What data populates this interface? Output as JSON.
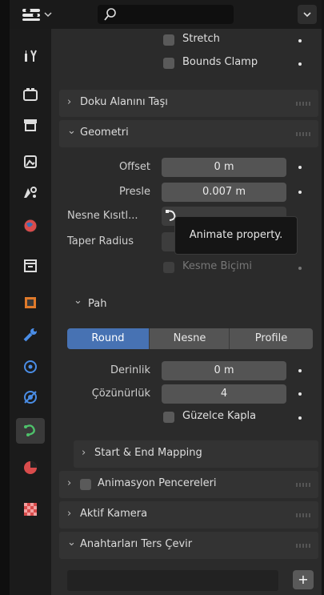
{
  "sections": {
    "stretch": "Stretch",
    "bounds_clamp": "Bounds Clamp",
    "doku": "Doku Alanını Taşı",
    "geometri": "Geometri",
    "offset_label": "Offset",
    "offset_value": "0 m",
    "presle_label": "Presle",
    "presle_value": "0.007 m",
    "nesne_kisit_label": "Nesne Kısıtl...",
    "taper_radius_label": "Taper Radius",
    "kesme_bicimi": "Kesme Biçimi",
    "pah": "Pah",
    "seg_round": "Round",
    "seg_nesne": "Nesne",
    "seg_profile": "Profile",
    "derinlik_label": "Derinlik",
    "derinlik_value": "0 m",
    "cozunurluk_label": "Çözünürlük",
    "cozunurluk_value": "4",
    "guzelce_kapla": "Güzelce Kapla",
    "start_end": "Start & End Mapping",
    "animasyon": "Animasyon Pencereleri",
    "aktif_kamera": "Aktif Kamera",
    "anahtarlari": "Anahtarları Ters Çevir",
    "plus": "+"
  },
  "tooltip": "Animate property.",
  "icons": {
    "search": "magnifier",
    "tabs": [
      "tool-icon",
      "render-icon",
      "output-icon",
      "view-layer-icon",
      "scene-icon",
      "world-icon",
      "collection-icon",
      "object-icon",
      "modifier-icon",
      "particles-icon",
      "physics-icon",
      "object-data-icon",
      "material-icon",
      "texture-icon"
    ]
  },
  "colors": {
    "accent_blue": "#4772b3"
  }
}
